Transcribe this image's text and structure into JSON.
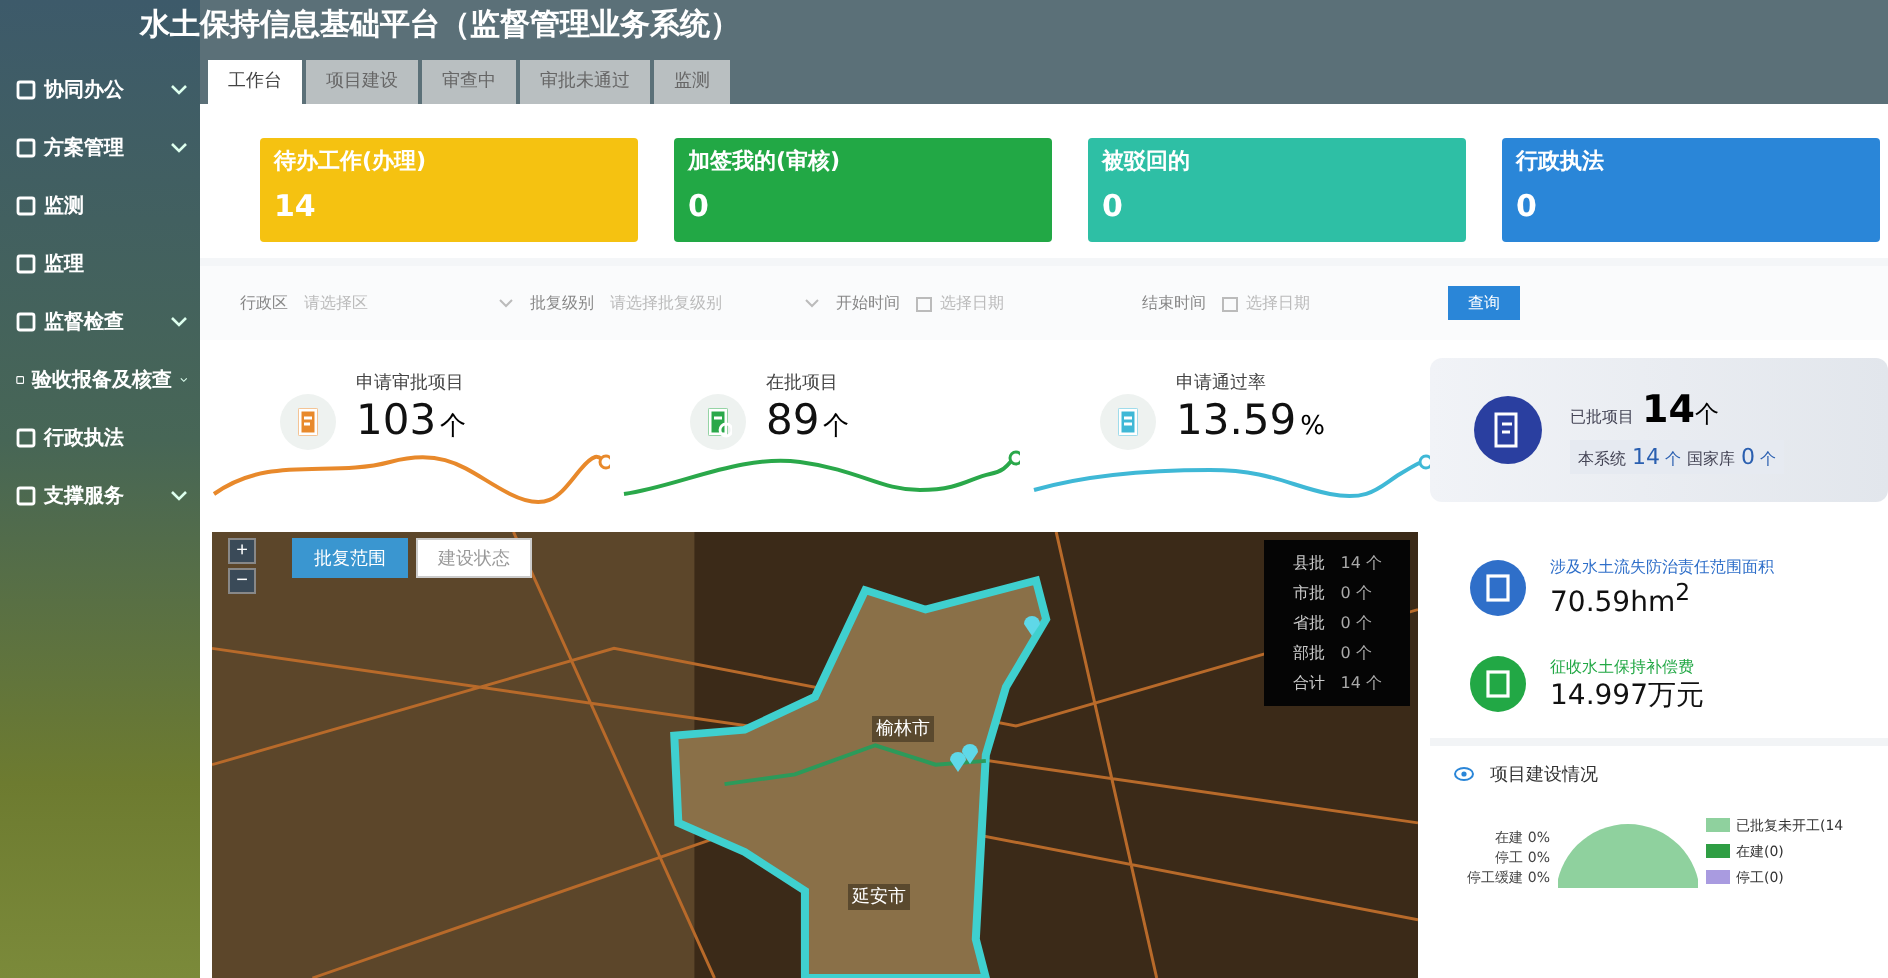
{
  "window": {
    "title": "水土保持信息基础平台（监督管理业务系统）"
  },
  "sidebar": {
    "items": [
      {
        "label": "协同办公",
        "expandable": true
      },
      {
        "label": "方案管理",
        "expandable": true
      },
      {
        "label": "监测",
        "expandable": false
      },
      {
        "label": "监理",
        "expandable": false
      },
      {
        "label": "监督检查",
        "expandable": true
      },
      {
        "label": "验收报备及核查",
        "expandable": true
      },
      {
        "label": "行政执法",
        "expandable": false
      },
      {
        "label": "支撑服务",
        "expandable": true
      }
    ]
  },
  "tabs": [
    {
      "label": "工作台",
      "selected": true
    },
    {
      "label": "项目建设",
      "selected": false
    },
    {
      "label": "审查中",
      "selected": false
    },
    {
      "label": "审批未通过",
      "selected": false
    },
    {
      "label": "监测",
      "selected": false
    }
  ],
  "task_cards": [
    {
      "title": "待办工作(办理)",
      "count": "14",
      "color": "#f5c211"
    },
    {
      "title": "加签我的(审核)",
      "count": "0",
      "color": "#22a845"
    },
    {
      "title": "被驳回的",
      "count": "0",
      "color": "#2ebfa5"
    },
    {
      "title": "行政执法",
      "count": "0",
      "color": "#2a86d8"
    }
  ],
  "filters": [
    {
      "label": "行政区",
      "placeholder": "请选择区",
      "kind": "select"
    },
    {
      "label": "批复级别",
      "placeholder": "请选择批复级别",
      "kind": "select"
    },
    {
      "label": "开始时间",
      "placeholder": "选择日期",
      "kind": "date"
    },
    {
      "label": "结束时间",
      "placeholder": "选择日期",
      "kind": "date"
    }
  ],
  "query_button": "查询",
  "stats": [
    {
      "label": "申请审批项目",
      "value": "103",
      "unit": "个",
      "color": "#e8892b"
    },
    {
      "label": "在批项目",
      "value": "89",
      "unit": "个",
      "color": "#2aa84a"
    },
    {
      "label": "申请通过率",
      "value": "13.59",
      "unit": "%",
      "color": "#3fb8d6"
    }
  ],
  "approved": {
    "label": "已批项目",
    "value": "14",
    "unit": "个",
    "sub": [
      {
        "label": "本系统",
        "value": "14",
        "unit": "个"
      },
      {
        "label": "国家库",
        "value": "0",
        "unit": "个"
      }
    ]
  },
  "map": {
    "buttons": [
      {
        "label": "批复范围",
        "selected": true
      },
      {
        "label": "建设状态",
        "selected": false
      }
    ],
    "zoom_in": "+",
    "zoom_out": "−",
    "cities": [
      "榆林市",
      "延安市"
    ],
    "legend": [
      {
        "label": "县批",
        "value": "14",
        "unit": "个"
      },
      {
        "label": "市批",
        "value": "0",
        "unit": "个"
      },
      {
        "label": "省批",
        "value": "0",
        "unit": "个"
      },
      {
        "label": "部批",
        "value": "0",
        "unit": "个"
      },
      {
        "label": "合计",
        "value": "14",
        "unit": "个"
      }
    ]
  },
  "metrics": [
    {
      "label": "涉及水土流失防治责任范围面积",
      "value": "70.59hm$^{2}$",
      "color": "#2f6fc9"
    },
    {
      "label": "征收水土保持补偿费",
      "value": "14.997万元",
      "color": "#22a845"
    }
  ],
  "construction": {
    "title": "项目建设情况",
    "pie_labels": [
      {
        "label": "在建",
        "pct": "0%"
      },
      {
        "label": "停工",
        "pct": "0%"
      },
      {
        "label": "停工缓建",
        "pct": "0%"
      }
    ],
    "legend": [
      {
        "label": "已批复未开工(14",
        "color": "#8fd19e"
      },
      {
        "label": "在建(0)",
        "color": "#2f9e44"
      },
      {
        "label": "停工(0)",
        "color": "#a99be0"
      }
    ]
  }
}
